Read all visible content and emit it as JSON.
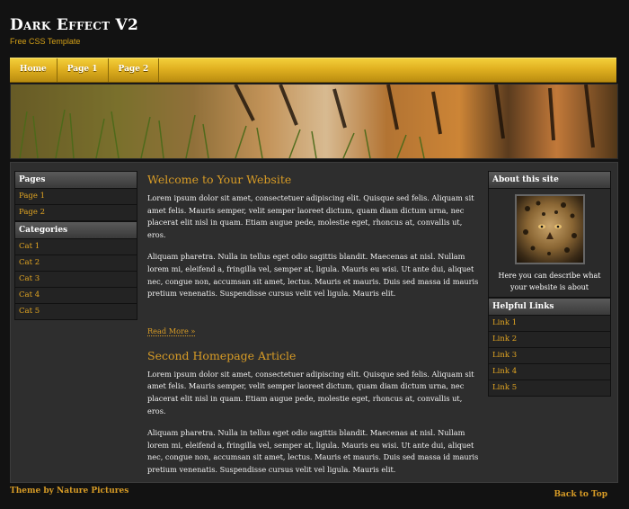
{
  "header": {
    "title": "Dark Effect V2",
    "subtitle": "Free CSS Template"
  },
  "nav": {
    "items": [
      "Home",
      "Page 1",
      "Page 2"
    ]
  },
  "left_sidebar": {
    "pages_heading": "Pages",
    "pages": [
      "Page 1",
      "Page 2"
    ],
    "categories_heading": "Categories",
    "categories": [
      "Cat 1",
      "Cat 2",
      "Cat 3",
      "Cat 4",
      "Cat 5"
    ]
  },
  "main": {
    "article1": {
      "title": "Welcome to Your Website",
      "p1": "Lorem ipsum dolor sit amet, consectetuer adipiscing elit. Quisque sed felis. Aliquam sit amet felis. Mauris semper, velit semper laoreet dictum, quam diam dictum urna, nec placerat elit nisl in quam. Etiam augue pede, molestie eget, rhoncus at, convallis ut, eros.",
      "p2": "Aliquam pharetra. Nulla in tellus eget odio sagittis blandit. Maecenas at nisl. Nullam lorem mi, eleifend a, fringilla vel, semper at, ligula. Mauris eu wisi. Ut ante dui, aliquet nec, congue non, accumsan sit amet, lectus. Mauris et mauris. Duis sed massa id mauris pretium venenatis. Suspendisse cursus velit vel ligula. Mauris elit.",
      "read_more": "Read More »"
    },
    "article2": {
      "title": "Second Homepage Article",
      "p1": "Lorem ipsum dolor sit amet, consectetuer adipiscing elit. Quisque sed felis. Aliquam sit amet felis. Mauris semper, velit semper laoreet dictum, quam diam dictum urna, nec placerat elit nisl in quam. Etiam augue pede, molestie eget, rhoncus at, convallis ut, eros.",
      "p2": "Aliquam pharetra. Nulla in tellus eget odio sagittis blandit. Maecenas at nisl. Nullam lorem mi, eleifend a, fringilla vel, semper at, ligula. Mauris eu wisi. Ut ante dui, aliquet nec, congue non, accumsan sit amet, lectus. Mauris et mauris. Duis sed massa id mauris pretium venenatis. Suspendisse cursus velit vel ligula. Mauris elit."
    }
  },
  "right_sidebar": {
    "about_heading": "About this site",
    "about_text": "Here you can describe what your website is about",
    "links_heading": "Helpful Links",
    "links": [
      "Link 1",
      "Link 2",
      "Link 3",
      "Link 4",
      "Link 5"
    ]
  },
  "footer": {
    "credit": "Theme by Nature Pictures",
    "back_to_top": "Back to Top"
  },
  "colors": {
    "accent": "#d89c26",
    "nav_gold": "#e0b020",
    "background": "#121212",
    "panel": "#2e2e2e"
  }
}
